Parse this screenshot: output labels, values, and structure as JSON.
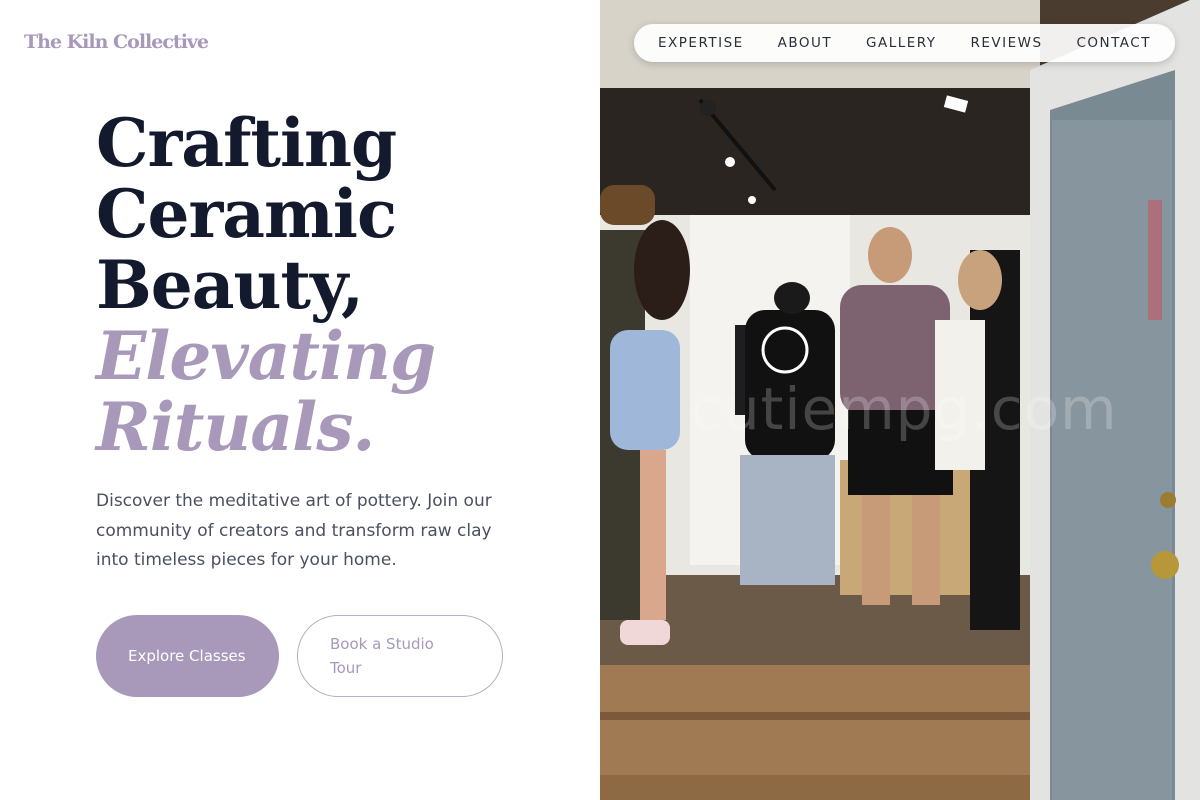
{
  "brand": {
    "name": "The Kiln Collective",
    "accent_color": "#a898ba",
    "text_color": "#141a2e"
  },
  "nav": {
    "items": [
      {
        "label": "EXPERTISE"
      },
      {
        "label": "ABOUT"
      },
      {
        "label": "GALLERY"
      },
      {
        "label": "REVIEWS"
      },
      {
        "label": "CONTACT"
      }
    ]
  },
  "hero": {
    "headline_lines": [
      "Crafting",
      "Ceramic",
      "Beauty,"
    ],
    "headline_accent_lines": [
      "Elevating",
      "Rituals."
    ],
    "subtitle": "Discover the meditative art of pottery. Join our community of creators and transform raw clay into timeless pieces for your home.",
    "primary_button": "Explore Classes",
    "secondary_button": "Book a Studio Tour"
  },
  "photo": {
    "watermark": "cutiempg.com"
  }
}
